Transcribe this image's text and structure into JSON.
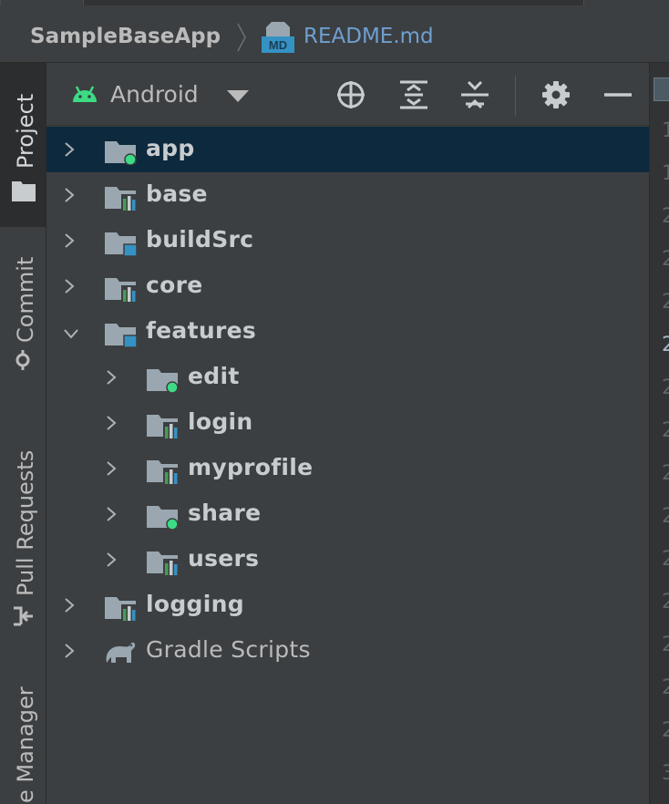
{
  "breadcrumb": {
    "project": "SampleBaseApp",
    "file": "README.md",
    "file_icon_text": "MD"
  },
  "toolwindows": {
    "project": "Project",
    "commit": "Commit",
    "pull_requests": "Pull Requests",
    "manager": "e Manager"
  },
  "panel": {
    "view_mode": "Android"
  },
  "tree": [
    {
      "label": "app",
      "type": "app-module",
      "expanded": false,
      "selected": true
    },
    {
      "label": "base",
      "type": "library-module",
      "expanded": false
    },
    {
      "label": "buildSrc",
      "type": "source-folder",
      "expanded": false
    },
    {
      "label": "core",
      "type": "library-module",
      "expanded": false
    },
    {
      "label": "features",
      "type": "source-folder",
      "expanded": true
    },
    {
      "label": "edit",
      "type": "app-module",
      "expanded": false,
      "indent": 1
    },
    {
      "label": "login",
      "type": "library-module",
      "expanded": false,
      "indent": 1
    },
    {
      "label": "myprofile",
      "type": "library-module",
      "expanded": false,
      "indent": 1
    },
    {
      "label": "share",
      "type": "app-module",
      "expanded": false,
      "indent": 1
    },
    {
      "label": "users",
      "type": "library-module",
      "expanded": false,
      "indent": 1
    },
    {
      "label": "logging",
      "type": "library-module",
      "expanded": false
    },
    {
      "label": "Gradle Scripts",
      "type": "gradle",
      "expanded": false
    }
  ],
  "gutter_digits": [
    "1",
    "1",
    "2",
    "2",
    "2",
    "2",
    "2",
    "2",
    "2",
    "2",
    "2",
    "2",
    "2",
    "2",
    "2",
    "3",
    "3"
  ],
  "colors": {
    "selection": "#0d293e",
    "android_green": "#3ddc84",
    "module_blue": "#3592c4",
    "module_green": "#499c54",
    "link": "#6f9fd1"
  }
}
